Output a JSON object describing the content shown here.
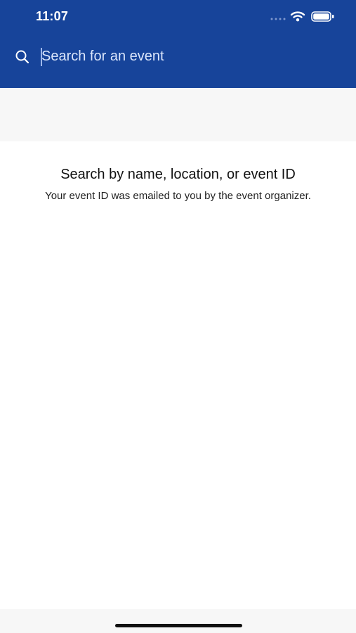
{
  "status_bar": {
    "time": "11:07",
    "icons": [
      "cellular-signal-icon",
      "wifi-icon",
      "battery-icon"
    ]
  },
  "search": {
    "icon": "search-icon",
    "placeholder": "Search for an event",
    "value": ""
  },
  "empty_state": {
    "title": "Search by name, location, or event ID",
    "subtitle": "Your event ID was emailed to you by the event organizer."
  },
  "colors": {
    "header": "#17449a",
    "band": "#f7f7f7",
    "background": "#ffffff",
    "text": "#111111"
  }
}
